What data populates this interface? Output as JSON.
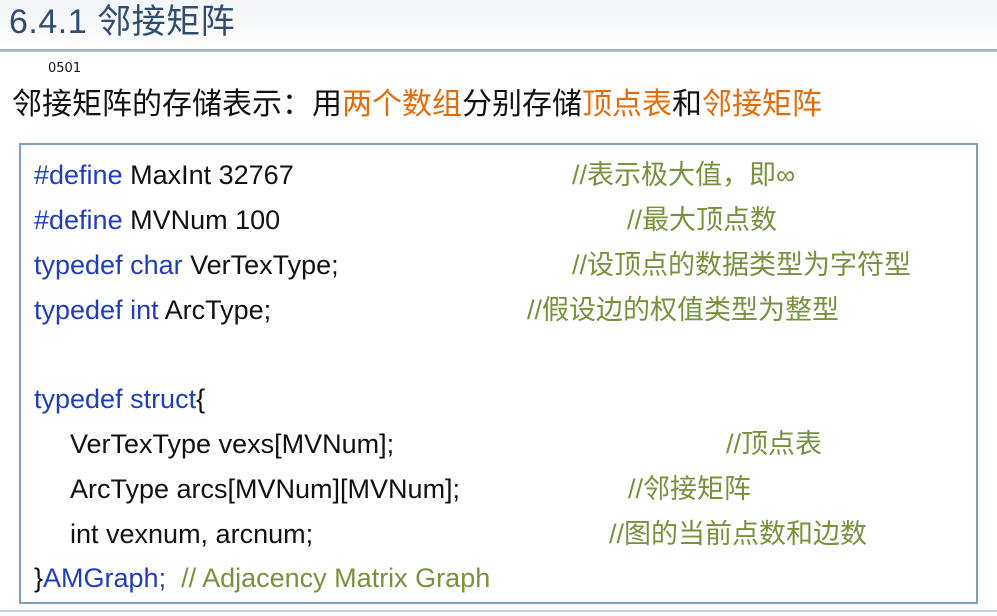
{
  "header": {
    "title": "6.4.1 邻接矩阵",
    "slide_number": "0501"
  },
  "headline": {
    "part1": "邻接矩阵的存储表示：用",
    "highlight1": "两个数组",
    "part2": "分别存储",
    "highlight2": "顶点表",
    "part3": "和",
    "highlight3": "邻接矩阵"
  },
  "code": {
    "lines": [
      {
        "kw": "#define",
        "text": " MaxInt 32767",
        "comment": "//表示极大值，即∞"
      },
      {
        "kw": "#define",
        "text": " MVNum 100",
        "comment": "//最大顶点数"
      },
      {
        "kw": "typedef char",
        "text": " VerTexType;",
        "comment": "//设顶点的数据类型为字符型"
      },
      {
        "kw": "typedef int",
        "text": " ArcType;",
        "comment": "//假设边的权值类型为整型"
      },
      {
        "kw": "typedef struct",
        "text": "{"
      },
      {
        "text": "VerTexType vexs[MVNum];",
        "comment": "//顶点表"
      },
      {
        "text": "ArcType arcs[MVNum][MVNum];",
        "comment": "//邻接矩阵"
      },
      {
        "text": "int vexnum, arcnum;",
        "comment": "//图的当前点数和边数"
      },
      {
        "prefix": "}",
        "kw": "AMGraph;",
        "comment": "// Adjacency Matrix Graph"
      }
    ]
  },
  "colors": {
    "title": "#2f4d73",
    "keyword": "#1f3dbf",
    "comment": "#76933c",
    "highlight": "#e36c0a",
    "box_border": "#7f9ec4"
  }
}
